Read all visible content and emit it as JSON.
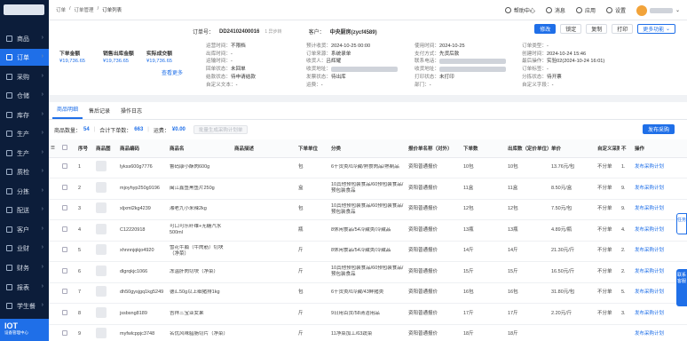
{
  "sidebar": {
    "items": [
      {
        "label": "商品",
        "active": false
      },
      {
        "label": "订单",
        "active": true
      },
      {
        "label": "采购",
        "active": false
      },
      {
        "label": "仓储",
        "active": false
      },
      {
        "label": "库存",
        "active": false
      },
      {
        "label": "生产",
        "active": false
      },
      {
        "label": "生产",
        "active": false
      },
      {
        "label": "质检",
        "active": false
      },
      {
        "label": "分拣",
        "active": false
      },
      {
        "label": "配送",
        "active": false
      },
      {
        "label": "客户",
        "active": false
      },
      {
        "label": "业财",
        "active": false
      },
      {
        "label": "财务",
        "active": false
      },
      {
        "label": "报表",
        "active": false
      },
      {
        "label": "学生餐",
        "active": false
      }
    ],
    "iot": {
      "title": "IOT",
      "subtitle": "设备管理中心"
    }
  },
  "topbar": {
    "breadcrumb": [
      "订单",
      "订单管理",
      "订单列表"
    ],
    "help": "帮助中心",
    "messages": "消息",
    "apps": "应用",
    "settings": "设置"
  },
  "header": {
    "order_no_label": "订单号：",
    "order_no": "DD24102400016",
    "order_tag": "1 异步转",
    "customer_label": "客户：",
    "customer": "中央厨房(zycf4589)",
    "buttons": {
      "modify": "修改",
      "lock": "锁定",
      "copy": "复制",
      "print": "打印",
      "more": "更多功能"
    },
    "summaries": [
      {
        "label": "下单金额",
        "value": "¥19,736.65"
      },
      {
        "label": "销售出库金额",
        "value": "¥19,736.65"
      },
      {
        "label": "实际成交额",
        "value": "¥19,736.65"
      }
    ],
    "more_link": "查看更多",
    "fields": {
      "col1": [
        {
          "label": "运营时间：",
          "value": "不限档"
        },
        {
          "label": "出库时间：",
          "value": "-"
        },
        {
          "label": "运输时间：",
          "value": "-"
        },
        {
          "label": "回单状态：",
          "value": "未回单"
        },
        {
          "label": "结款状态：",
          "value": "待申请结款"
        },
        {
          "label": "自定义文本：",
          "value": "-"
        }
      ],
      "col2": [
        {
          "label": "预计收货：",
          "value": "2024-10-25 00:00"
        },
        {
          "label": "订单来源：",
          "value": "系统录单"
        },
        {
          "label": "收货人：",
          "value": "吕辉耀"
        },
        {
          "label": "收货地址：",
          "value": ""
        },
        {
          "label": "发票状态：",
          "value": "待出库"
        },
        {
          "label": "运费：",
          "value": "-"
        }
      ],
      "col3": [
        {
          "label": "使用时间：",
          "value": "2024-10-25"
        },
        {
          "label": "支付方式：",
          "value": "先货后款"
        },
        {
          "label": "联系电话：",
          "value": ""
        },
        {
          "label": "收货地址：",
          "value": ""
        },
        {
          "label": "打印状态：",
          "value": "未打印"
        },
        {
          "label": "部门：",
          "value": "-"
        }
      ],
      "col4": [
        {
          "label": "订单类型：",
          "value": "-"
        },
        {
          "label": "创建时间：",
          "value": "2024-10-24 15:46"
        },
        {
          "label": "最后操作：",
          "value": "实验02(2024-10-24 16:01)"
        },
        {
          "label": "订单标签：",
          "value": "-"
        },
        {
          "label": "分拣状态：",
          "value": "待开票"
        },
        {
          "label": "自定义字段：",
          "value": "-"
        }
      ]
    }
  },
  "tabs": [
    "商品明细",
    "售后记录",
    "操作日志"
  ],
  "summary_bar": {
    "count_label": "商品数量：",
    "count": "54",
    "order_total_label": "合计下单数：",
    "order_total": "663",
    "amount_label": "运费：",
    "amount": "¥0.00",
    "generate_btn": "批量生成采购计划单",
    "publish_btn": "发布采购"
  },
  "table": {
    "columns": [
      "序号",
      "商品图",
      "商品编码",
      "商品名",
      "商品描述",
      "下单单位",
      "分类",
      "报价单名称（对外）",
      "下单数",
      "出库数（定价单位）",
      "单价",
      "自定义采购类型",
      "不",
      "操作"
    ],
    "rows": [
      {
        "idx": "1",
        "code": "lykss600g7776",
        "name": "鲁码康小酥肉600g",
        "unit": "包",
        "cat": "6干货类/0冷藏/熟食肉品/熟制品",
        "quote": "资阳普通报价",
        "qty": "10包",
        "out": "10包",
        "price": "13.76元/包",
        "type": "不分单",
        "x": "1.",
        "op": "发布采购计划"
      },
      {
        "idx": "2",
        "code": "mjoyhyp250g9196",
        "name": "闽江鑫鱼黑鱼片250g",
        "unit": "盒",
        "cat": "10其他预包装食品/60预包装食品/预包装食品",
        "quote": "资阳普通报价",
        "qty": "11盒",
        "out": "11盒",
        "price": "8.50元/盒",
        "type": "不分单",
        "x": "9.",
        "op": "发布采购计划"
      },
      {
        "idx": "3",
        "code": "xljxml2kg4239",
        "name": "湘老九小米辣2kg",
        "unit": "包",
        "cat": "10其他预包装食品/60预包装食品/预包装食品",
        "quote": "资阳普通报价",
        "qty": "12包",
        "out": "12包",
        "price": "7.50元/包",
        "type": "不分单",
        "x": "9.",
        "op": "发布采购计划"
      },
      {
        "idx": "4",
        "code": "C12220918",
        "name": "可口可乐纤维+无糖汽水500ml",
        "unit": "瓶",
        "cat": "8休闲食品/54冷藏类/冷藏品",
        "quote": "资阳普通报价",
        "qty": "13瓶",
        "out": "13瓶",
        "price": "4.89元/瓶",
        "type": "不分单",
        "x": "4.",
        "op": "发布采购计划"
      },
      {
        "idx": "5",
        "code": "xhnnnjqkjo4920",
        "name": "雪花牛腩（牛肉筋）切块（净菜）",
        "unit": "斤",
        "cat": "8休闲食品/54冷藏类/冷藏品",
        "quote": "资阳普通报价",
        "qty": "14斤",
        "out": "14斤",
        "price": "21.30元/斤",
        "type": "不分单",
        "x": "2.",
        "op": "发布采购计划"
      },
      {
        "idx": "6",
        "code": "dlgrqkjc1066",
        "name": "冻温肝肉切块（净菜）",
        "unit": "斤",
        "cat": "10其他预包装食品/60预包装食品/预包装食品",
        "quote": "资阳普通报价",
        "qty": "15斤",
        "out": "15斤",
        "price": "16.50元/斤",
        "type": "不分单",
        "x": "2.",
        "op": "发布采购计划"
      },
      {
        "idx": "7",
        "code": "dh50gysjgq1kg5249",
        "name": "德汇50g以上细猪排1kg",
        "unit": "包",
        "cat": "6干货类/0冷藏/43鲜猪类",
        "quote": "资阳普通报价",
        "qty": "16包",
        "out": "16包",
        "price": "31.80元/包",
        "type": "不分单",
        "x": "5.",
        "op": "发布采购计划"
      },
      {
        "idx": "8",
        "code": "jssbsng8189",
        "name": "吉祥三宝亚女果",
        "unit": "斤",
        "cat": "9日用百货/58清洁用品",
        "quote": "资阳普通报价",
        "qty": "17斤",
        "out": "17斤",
        "price": "2.20元/斤",
        "type": "不分单",
        "x": "3.",
        "op": "发布采购计划"
      },
      {
        "idx": "9",
        "code": "myfwlcppjc3748",
        "name": "名优风味腊肠切片（净菜）",
        "unit": "斤",
        "cat": "11净菜加工/63蔬菜",
        "quote": "资阳普通报价",
        "qty": "18斤",
        "out": "18斤",
        "price": "",
        "type": "",
        "x": "",
        "op": "发布采购计划"
      }
    ]
  },
  "float_buttons": {
    "task": "任务",
    "assist": "联系客服"
  }
}
